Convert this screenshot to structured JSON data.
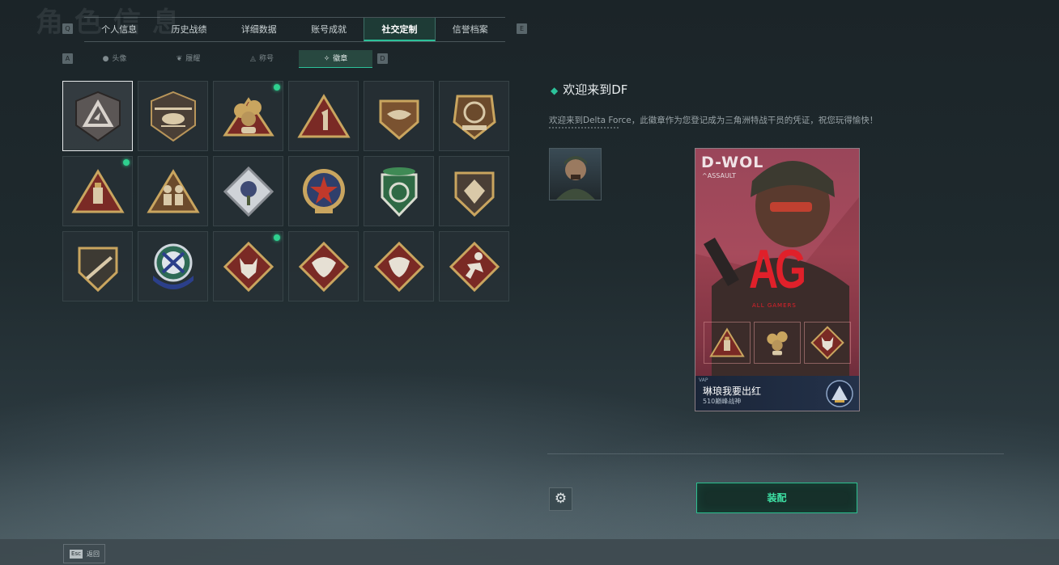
{
  "page_bg_title": "角色信息",
  "hotkeys": {
    "prev_tab": "Q",
    "next_tab": "E",
    "prev_sub": "A",
    "next_sub": "D"
  },
  "tabs": [
    {
      "label": "个人信息",
      "active": false
    },
    {
      "label": "历史战绩",
      "active": false
    },
    {
      "label": "详细数据",
      "active": false
    },
    {
      "label": "账号成就",
      "active": false
    },
    {
      "label": "社交定制",
      "active": true
    },
    {
      "label": "信誉档案",
      "active": false
    }
  ],
  "subtabs": [
    {
      "label": "头像",
      "icon": "user-icon",
      "glyph": "●",
      "active": false
    },
    {
      "label": "履耀",
      "icon": "laurel-icon",
      "glyph": "❦",
      "active": false
    },
    {
      "label": "称号",
      "icon": "title-icon",
      "glyph": "◬",
      "active": false
    },
    {
      "label": "徽章",
      "icon": "badge-icon",
      "glyph": "✧",
      "active": true
    }
  ],
  "badges": [
    {
      "name": "gray-triangle-shield",
      "selected": true,
      "new": false
    },
    {
      "name": "helicopter-shield",
      "selected": false,
      "new": false
    },
    {
      "name": "gold-chain-510",
      "selected": false,
      "new": true
    },
    {
      "name": "number-one-triangle",
      "selected": false,
      "new": false
    },
    {
      "name": "delta-force-handshake",
      "selected": false,
      "new": false
    },
    {
      "name": "delta-force-2026",
      "selected": false,
      "new": false
    },
    {
      "name": "usb-triangle",
      "selected": false,
      "new": true
    },
    {
      "name": "soldiers-triangle",
      "selected": false,
      "new": false
    },
    {
      "name": "rose-diamond",
      "selected": false,
      "new": false
    },
    {
      "name": "star-medal",
      "selected": false,
      "new": false
    },
    {
      "name": "green-shield-laurel",
      "selected": false,
      "new": false
    },
    {
      "name": "diamond-shield",
      "selected": false,
      "new": false
    },
    {
      "name": "rifle-shield",
      "selected": false,
      "new": false
    },
    {
      "name": "crossed-arrows-blue",
      "selected": false,
      "new": false
    },
    {
      "name": "wolf-diamond",
      "selected": false,
      "new": true
    },
    {
      "name": "dragon-diamond",
      "selected": false,
      "new": false
    },
    {
      "name": "dragon-diamond-2",
      "selected": false,
      "new": false
    },
    {
      "name": "runner-diamond",
      "selected": false,
      "new": false
    }
  ],
  "detail": {
    "title": "欢迎来到DF",
    "description": "欢迎来到Delta Force，此徽章作为您登记成为三角洲特战干员的凭证，祝您玩得愉快！"
  },
  "card": {
    "operator_name": "D-WOL",
    "operator_class": "^ASSAULT",
    "team_logo": "AG",
    "team_logo_sub": "ALL GAMERS",
    "footer_tag": "VAP",
    "player_name": "琳琅我要出红",
    "rank": "510巅峰战神"
  },
  "actions": {
    "equip_label": "装配",
    "settings_icon": "gear-icon"
  },
  "footer": {
    "esc_key": "Esc",
    "esc_label": "返回"
  },
  "colors": {
    "accent": "#2cc29a",
    "new_dot": "#2fd08f",
    "badge_gold": "#b8955a",
    "badge_red": "#7a2a25"
  }
}
